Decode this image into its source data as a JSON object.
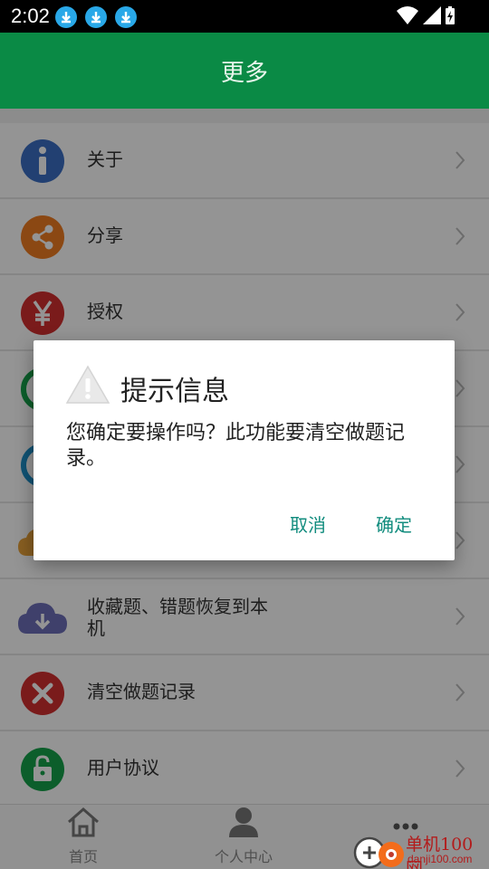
{
  "status_bar": {
    "time": "2:02"
  },
  "app_bar": {
    "title": "更多"
  },
  "menu": {
    "items": [
      {
        "label": "关于",
        "icon": "info-icon"
      },
      {
        "label": "分享",
        "icon": "share-icon"
      },
      {
        "label": "授权",
        "icon": "yen-icon"
      },
      {
        "label": "",
        "icon": "circle-icon"
      },
      {
        "label": "",
        "icon": "circle-icon"
      },
      {
        "label": "",
        "icon": "cloud-icon"
      },
      {
        "label": "收藏题、错题恢复到本机",
        "icon": "cloud-download-icon"
      },
      {
        "label": "清空做题记录",
        "icon": "clear-icon"
      },
      {
        "label": "用户协议",
        "icon": "lock-icon"
      }
    ]
  },
  "tabs": [
    {
      "label": "首页",
      "icon": "home-icon"
    },
    {
      "label": "个人中心",
      "icon": "user-icon"
    },
    {
      "label": "",
      "icon": "more-icon"
    }
  ],
  "dialog": {
    "title": "提示信息",
    "message": "您确定要操作吗？此功能要清空做题记录。",
    "cancel": "取消",
    "confirm": "确定"
  },
  "watermark": {
    "name": "单机100网",
    "domain": "danji100.com"
  },
  "colors": {
    "primary": "#0a8a45",
    "accent": "#128c7e",
    "info": "#3b6fc4",
    "share": "#ef7d22",
    "yen": "#d32f2f",
    "clear": "#d32f2f",
    "lock": "#16a34a",
    "cloud": "#6d6fb8"
  }
}
